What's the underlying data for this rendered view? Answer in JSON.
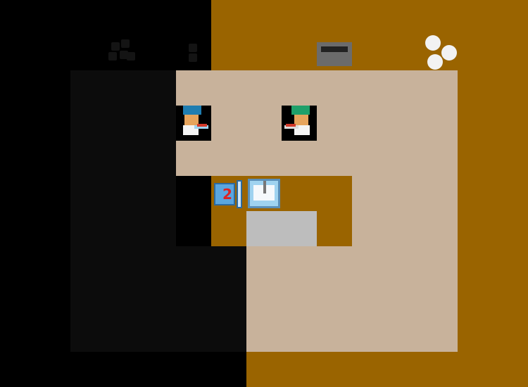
{
  "game": {
    "title": "",
    "pot_ingredient_count": "2"
  },
  "colors": {
    "counter": "#9a6400",
    "floor": "#c8b29b",
    "shadow": "#000000",
    "serving_window": "#bdbdbd",
    "chef_1_hat": "#1f7db0",
    "chef_2_hat": "#1fa06a"
  },
  "icons": {
    "onion_dispenser": "onion-dispenser-icon",
    "dish_dispenser": "dish-dispenser-icon",
    "pot": "pot-icon",
    "cutting_board": "cutting-board-icon",
    "serving_counter": "serving-counter-icon",
    "chef_1": "chef-blue-icon",
    "chef_2": "chef-green-icon"
  }
}
